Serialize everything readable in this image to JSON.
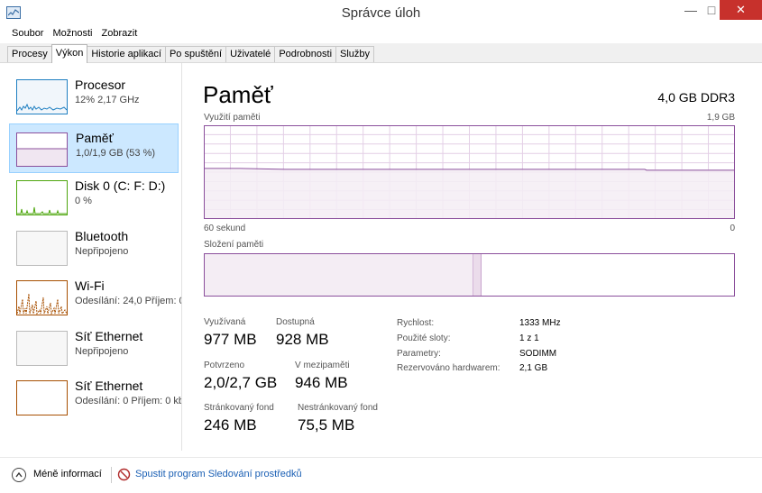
{
  "window": {
    "title": "Správce úloh",
    "close_glyph": "✕",
    "min_glyph": "—",
    "max_glyph": "□"
  },
  "menu": [
    "Soubor",
    "Možnosti",
    "Zobrazit"
  ],
  "tabs": [
    {
      "label": "Procesy",
      "active": false
    },
    {
      "label": "Výkon",
      "active": true
    },
    {
      "label": "Historie aplikací",
      "active": false
    },
    {
      "label": "Po spuštění",
      "active": false
    },
    {
      "label": "Uživatelé",
      "active": false
    },
    {
      "label": "Podrobnosti",
      "active": false
    },
    {
      "label": "Služby",
      "active": false
    }
  ],
  "sidebar": {
    "items": [
      {
        "name": "Procesor",
        "sub": "12% 2,17 GHz",
        "color": "#1f7fc1",
        "selected": false
      },
      {
        "name": "Paměť",
        "sub": "1,0/1,9 GB (53 %)",
        "color": "#8b4f9c",
        "selected": true
      },
      {
        "name": "Disk 0 (C: F: D:)",
        "sub": "0 %",
        "color": "#4da60c",
        "selected": false
      },
      {
        "name": "Bluetooth",
        "sub": "Nepřipojeno",
        "color": "#aaaaaa",
        "selected": false
      },
      {
        "name": "Wi-Fi",
        "sub": "Odesílání: 24,0 Příjem: 0",
        "color": "#a74f01",
        "selected": false
      },
      {
        "name": "Síť Ethernet",
        "sub": "Nepřipojeno",
        "color": "#aaaaaa",
        "selected": false
      },
      {
        "name": "Síť Ethernet",
        "sub": "Odesílání: 0 Příjem: 0 kb",
        "color": "#a74f01",
        "selected": false
      }
    ]
  },
  "main": {
    "title": "Paměť",
    "capacity": "4,0 GB DDR3",
    "usage_label": "Využití paměti",
    "usage_max": "1,9 GB",
    "time_left": "60 sekund",
    "time_right": "0",
    "composition_label": "Složení paměti",
    "usage_level_fraction": 0.53,
    "stats": {
      "used_label": "Využívaná",
      "used_value": "977 MB",
      "available_label": "Dostupná",
      "available_value": "928 MB",
      "committed_label": "Potvrzeno",
      "committed_value": "2,0/2,7 GB",
      "cached_label": "V mezipaměti",
      "cached_value": "946 MB",
      "paged_label": "Stránkovaný fond",
      "paged_value": "246 MB",
      "nonpaged_label": "Nestránkovaný fond",
      "nonpaged_value": "75,5 MB"
    },
    "details": [
      {
        "key": "Rychlost:",
        "value": "1333 MHz"
      },
      {
        "key": "Použité sloty:",
        "value": "1 z 1"
      },
      {
        "key": "Parametry:",
        "value": "SODIMM"
      },
      {
        "key": "Rezervováno hardwarem:",
        "value": "2,1 GB"
      }
    ]
  },
  "footer": {
    "less_info": "Méně informací",
    "monitor_link": "Spustit program Sledování prostředků"
  },
  "colors": {
    "memory_accent": "#8b4f9c",
    "grid": "#e3cfe6",
    "fill": "#f4edf4",
    "selected_bg": "#cce8ff"
  }
}
